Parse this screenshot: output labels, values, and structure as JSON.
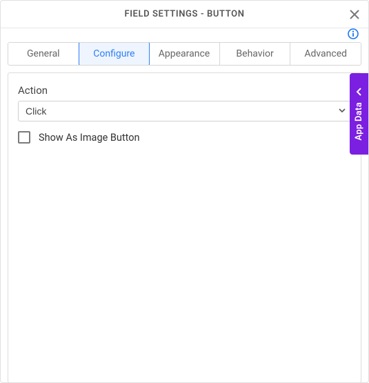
{
  "header": {
    "title": "FIELD SETTINGS - BUTTON"
  },
  "tabs": [
    {
      "label": "General",
      "active": false
    },
    {
      "label": "Configure",
      "active": true
    },
    {
      "label": "Appearance",
      "active": false
    },
    {
      "label": "Behavior",
      "active": false
    },
    {
      "label": "Advanced",
      "active": false
    }
  ],
  "form": {
    "action_label": "Action",
    "action_value": "Click",
    "show_as_image_label": "Show As Image Button",
    "show_as_image_checked": false
  },
  "side_drawer": {
    "label": "App Data"
  },
  "colors": {
    "accent": "#2f7ef6",
    "drawer": "#7b1fe0"
  }
}
